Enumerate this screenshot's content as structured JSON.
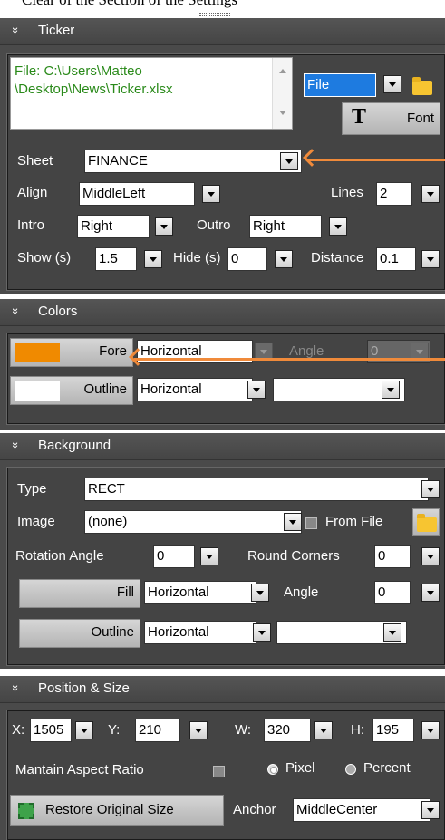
{
  "top_cut_text": "Clear of the Section of the Settings",
  "ticker": {
    "title": "Ticker",
    "file_text": "File: C:\\Users\\Matteo \\Desktop\\News\\Ticker.xlsx",
    "source_select": "File",
    "font_button": "Font",
    "font_icon_glyph": "T",
    "sheet_label": "Sheet",
    "sheet_value": "FINANCE",
    "align_label": "Align",
    "align_value": "MiddleLeft",
    "lines_label": "Lines",
    "lines_value": "2",
    "intro_label": "Intro",
    "intro_value": "Right",
    "outro_label": "Outro",
    "outro_value": "Right",
    "show_label": "Show (s)",
    "show_value": "1.5",
    "hide_label": "Hide (s)",
    "hide_value": "0",
    "distance_label": "Distance",
    "distance_value": "0.1"
  },
  "colors": {
    "title": "Colors",
    "fore_label": "Fore",
    "fore_color": "#f08a00",
    "fore_gradient": "Horizontal",
    "angle_label": "Angle",
    "angle_value": "0",
    "outline_label": "Outline",
    "outline_color": "#ffffff",
    "outline_gradient": "Horizontal",
    "outline_extra": ""
  },
  "background": {
    "title": "Background",
    "type_label": "Type",
    "type_value": "RECT",
    "image_label": "Image",
    "image_value": "(none)",
    "from_file_label": "From File",
    "rotation_label": "Rotation Angle",
    "rotation_value": "0",
    "round_label": "Round Corners",
    "round_value": "0",
    "fill_label": "Fill",
    "fill_gradient": "Horizontal",
    "angle_label": "Angle",
    "angle_value": "0",
    "outline_label": "Outline",
    "outline_gradient": "Horizontal",
    "outline_extra": ""
  },
  "position": {
    "title": "Position & Size",
    "x_label": "X:",
    "x_value": "1505",
    "y_label": "Y:",
    "y_value": "210",
    "w_label": "W:",
    "w_value": "320",
    "h_label": "H:",
    "h_value": "195",
    "aspect_label": "Mantain Aspect Ratio",
    "pixel_label": "Pixel",
    "percent_label": "Percent",
    "restore_label": "Restore Original Size",
    "anchor_label": "Anchor",
    "anchor_value": "MiddleCenter"
  },
  "annotation_color": "#f08a3a",
  "chevron_glyph": "»"
}
